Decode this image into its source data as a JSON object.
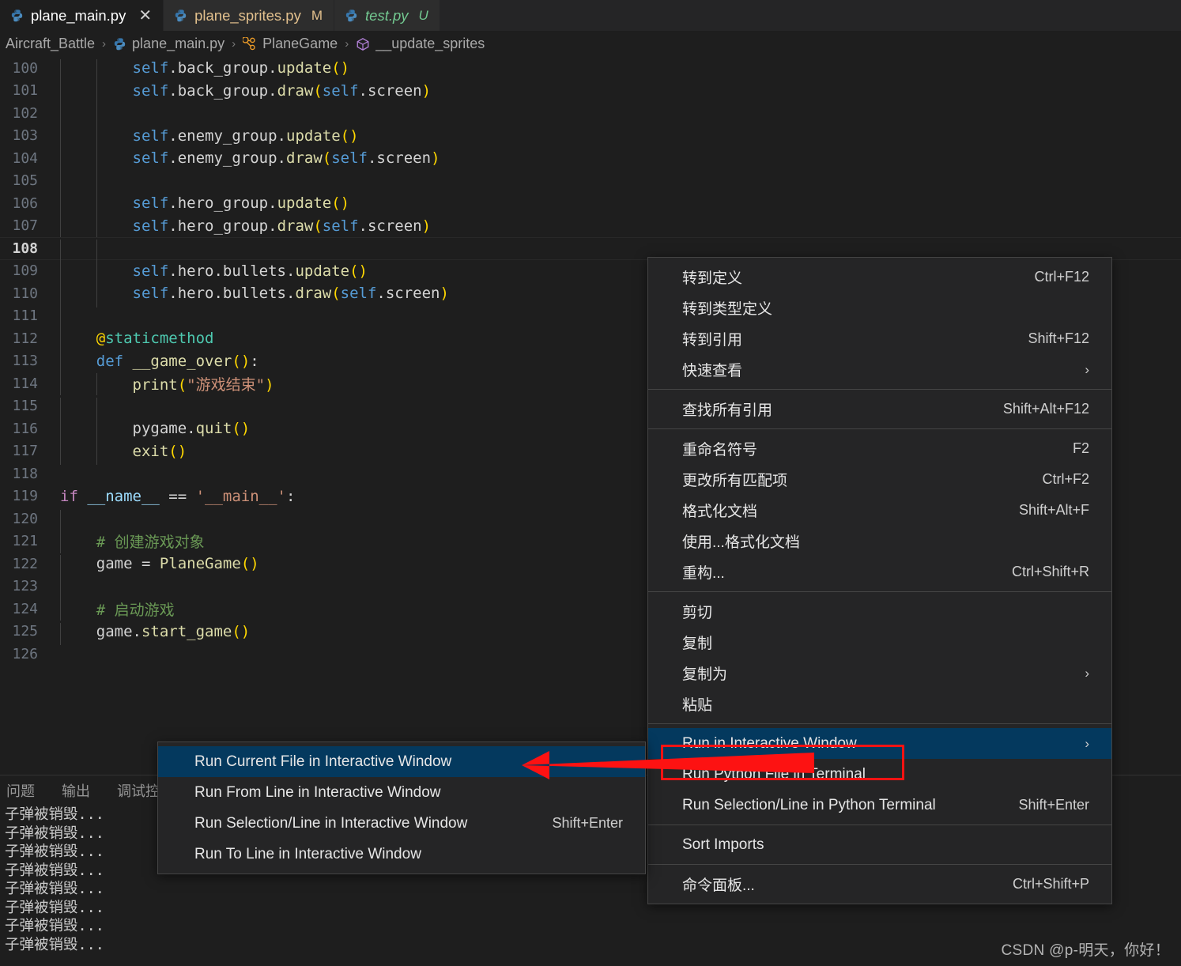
{
  "window": {
    "theme_bg": "#1e1e1e",
    "accent_highlight": "#04395e",
    "annotation_color": "#fd1212"
  },
  "tabs": [
    {
      "label": "plane_main.py",
      "badge": "",
      "close": "✕",
      "state": "active",
      "icon": "python-icon"
    },
    {
      "label": "plane_sprites.py",
      "badge": "M",
      "close": "",
      "state": "modified",
      "icon": "python-icon"
    },
    {
      "label": "test.py",
      "badge": "U",
      "close": "",
      "state": "untracked",
      "icon": "python-icon"
    }
  ],
  "breadcrumb": {
    "items": [
      {
        "label": "Aircraft_Battle",
        "icon": ""
      },
      {
        "label": "plane_main.py",
        "icon": "python-icon"
      },
      {
        "label": "PlaneGame",
        "icon": "class-icon"
      },
      {
        "label": "__update_sprites",
        "icon": "method-icon"
      }
    ],
    "separator": "›"
  },
  "editor": {
    "lines": [
      {
        "no": "100",
        "indent": 2,
        "current": false,
        "tokens": [
          {
            "t": "self",
            "c": "t-self"
          },
          {
            "t": ".back_group.",
            "c": "t-id"
          },
          {
            "t": "update",
            "c": "t-call"
          },
          {
            "t": "()",
            "c": "t-par"
          }
        ]
      },
      {
        "no": "101",
        "indent": 2,
        "current": false,
        "tokens": [
          {
            "t": "self",
            "c": "t-self"
          },
          {
            "t": ".back_group.",
            "c": "t-id"
          },
          {
            "t": "draw",
            "c": "t-call"
          },
          {
            "t": "(",
            "c": "t-par"
          },
          {
            "t": "self",
            "c": "t-self"
          },
          {
            "t": ".screen",
            "c": "t-id"
          },
          {
            "t": ")",
            "c": "t-par"
          }
        ]
      },
      {
        "no": "102",
        "indent": 2,
        "current": false,
        "tokens": []
      },
      {
        "no": "103",
        "indent": 2,
        "current": false,
        "tokens": [
          {
            "t": "self",
            "c": "t-self"
          },
          {
            "t": ".enemy_group.",
            "c": "t-id"
          },
          {
            "t": "update",
            "c": "t-call"
          },
          {
            "t": "()",
            "c": "t-par"
          }
        ]
      },
      {
        "no": "104",
        "indent": 2,
        "current": false,
        "tokens": [
          {
            "t": "self",
            "c": "t-self"
          },
          {
            "t": ".enemy_group.",
            "c": "t-id"
          },
          {
            "t": "draw",
            "c": "t-call"
          },
          {
            "t": "(",
            "c": "t-par"
          },
          {
            "t": "self",
            "c": "t-self"
          },
          {
            "t": ".screen",
            "c": "t-id"
          },
          {
            "t": ")",
            "c": "t-par"
          }
        ]
      },
      {
        "no": "105",
        "indent": 2,
        "current": false,
        "tokens": []
      },
      {
        "no": "106",
        "indent": 2,
        "current": false,
        "tokens": [
          {
            "t": "self",
            "c": "t-self"
          },
          {
            "t": ".hero_group.",
            "c": "t-id"
          },
          {
            "t": "update",
            "c": "t-call"
          },
          {
            "t": "()",
            "c": "t-par"
          }
        ]
      },
      {
        "no": "107",
        "indent": 2,
        "current": false,
        "tokens": [
          {
            "t": "self",
            "c": "t-self"
          },
          {
            "t": ".hero_group.",
            "c": "t-id"
          },
          {
            "t": "draw",
            "c": "t-call"
          },
          {
            "t": "(",
            "c": "t-par"
          },
          {
            "t": "self",
            "c": "t-self"
          },
          {
            "t": ".screen",
            "c": "t-id"
          },
          {
            "t": ")",
            "c": "t-par"
          }
        ]
      },
      {
        "no": "108",
        "indent": 2,
        "current": true,
        "tokens": []
      },
      {
        "no": "109",
        "indent": 2,
        "current": false,
        "tokens": [
          {
            "t": "self",
            "c": "t-self"
          },
          {
            "t": ".hero.bullets.",
            "c": "t-id"
          },
          {
            "t": "update",
            "c": "t-call"
          },
          {
            "t": "()",
            "c": "t-par"
          }
        ]
      },
      {
        "no": "110",
        "indent": 2,
        "current": false,
        "tokens": [
          {
            "t": "self",
            "c": "t-self"
          },
          {
            "t": ".hero.bullets.",
            "c": "t-id"
          },
          {
            "t": "draw",
            "c": "t-call"
          },
          {
            "t": "(",
            "c": "t-par"
          },
          {
            "t": "self",
            "c": "t-self"
          },
          {
            "t": ".screen",
            "c": "t-id"
          },
          {
            "t": ")",
            "c": "t-par"
          }
        ]
      },
      {
        "no": "111",
        "indent": 1,
        "current": false,
        "tokens": []
      },
      {
        "no": "112",
        "indent": 1,
        "current": false,
        "tokens": [
          {
            "t": "@",
            "c": "t-par"
          },
          {
            "t": "staticmethod",
            "c": "t-dec"
          }
        ]
      },
      {
        "no": "113",
        "indent": 1,
        "current": false,
        "tokens": [
          {
            "t": "def ",
            "c": "t-kw"
          },
          {
            "t": "__game_over",
            "c": "t-fn"
          },
          {
            "t": "()",
            "c": "t-par"
          },
          {
            "t": ":",
            "c": "t-id"
          }
        ]
      },
      {
        "no": "114",
        "indent": 2,
        "current": false,
        "tokens": [
          {
            "t": "print",
            "c": "t-call"
          },
          {
            "t": "(",
            "c": "t-par"
          },
          {
            "t": "\"游戏结束\"",
            "c": "t-str"
          },
          {
            "t": ")",
            "c": "t-par"
          }
        ]
      },
      {
        "no": "115",
        "indent": 2,
        "current": false,
        "tokens": []
      },
      {
        "no": "116",
        "indent": 2,
        "current": false,
        "tokens": [
          {
            "t": "pygame.",
            "c": "t-id"
          },
          {
            "t": "quit",
            "c": "t-call"
          },
          {
            "t": "()",
            "c": "t-par"
          }
        ]
      },
      {
        "no": "117",
        "indent": 2,
        "current": false,
        "tokens": [
          {
            "t": "exit",
            "c": "t-call"
          },
          {
            "t": "()",
            "c": "t-par"
          }
        ]
      },
      {
        "no": "118",
        "indent": 0,
        "current": false,
        "tokens": []
      },
      {
        "no": "119",
        "indent": 0,
        "current": false,
        "tokens": [
          {
            "t": "if ",
            "c": "t-kw2"
          },
          {
            "t": "__name__",
            "c": "t-var"
          },
          {
            "t": " == ",
            "c": "t-id"
          },
          {
            "t": "'__main__'",
            "c": "t-str"
          },
          {
            "t": ":",
            "c": "t-id"
          }
        ]
      },
      {
        "no": "120",
        "indent": 1,
        "current": false,
        "tokens": []
      },
      {
        "no": "121",
        "indent": 1,
        "current": false,
        "tokens": [
          {
            "t": "# 创建游戏对象",
            "c": "t-cmt"
          }
        ]
      },
      {
        "no": "122",
        "indent": 1,
        "current": false,
        "tokens": [
          {
            "t": "game = ",
            "c": "t-id"
          },
          {
            "t": "PlaneGame",
            "c": "t-call"
          },
          {
            "t": "()",
            "c": "t-par"
          }
        ]
      },
      {
        "no": "123",
        "indent": 1,
        "current": false,
        "tokens": []
      },
      {
        "no": "124",
        "indent": 1,
        "current": false,
        "tokens": [
          {
            "t": "# 启动游戏",
            "c": "t-cmt"
          }
        ]
      },
      {
        "no": "125",
        "indent": 1,
        "current": false,
        "tokens": [
          {
            "t": "game.",
            "c": "t-id"
          },
          {
            "t": "start_game",
            "c": "t-call"
          },
          {
            "t": "()",
            "c": "t-par"
          }
        ]
      },
      {
        "no": "126",
        "indent": 0,
        "current": false,
        "tokens": []
      }
    ]
  },
  "panel": {
    "tabs": [
      {
        "label": "问题"
      },
      {
        "label": "输出"
      },
      {
        "label": "调试控"
      }
    ],
    "output_lines": [
      "子弹被销毁...",
      "子弹被销毁...",
      "子弹被销毁...",
      "子弹被销毁...",
      "子弹被销毁...",
      "子弹被销毁...",
      "子弹被销毁...",
      "子弹被销毁..."
    ]
  },
  "context_menu": {
    "groups": [
      {
        "items": [
          {
            "label": "转到定义",
            "shortcut": "Ctrl+F12",
            "chevron": false,
            "highlight": false
          },
          {
            "label": "转到类型定义",
            "shortcut": "",
            "chevron": false,
            "highlight": false
          },
          {
            "label": "转到引用",
            "shortcut": "Shift+F12",
            "chevron": false,
            "highlight": false
          },
          {
            "label": "快速查看",
            "shortcut": "",
            "chevron": true,
            "highlight": false
          }
        ]
      },
      {
        "items": [
          {
            "label": "查找所有引用",
            "shortcut": "Shift+Alt+F12",
            "chevron": false,
            "highlight": false
          }
        ]
      },
      {
        "items": [
          {
            "label": "重命名符号",
            "shortcut": "F2",
            "chevron": false,
            "highlight": false
          },
          {
            "label": "更改所有匹配项",
            "shortcut": "Ctrl+F2",
            "chevron": false,
            "highlight": false
          },
          {
            "label": "格式化文档",
            "shortcut": "Shift+Alt+F",
            "chevron": false,
            "highlight": false
          },
          {
            "label": "使用...格式化文档",
            "shortcut": "",
            "chevron": false,
            "highlight": false
          },
          {
            "label": "重构...",
            "shortcut": "Ctrl+Shift+R",
            "chevron": false,
            "highlight": false
          }
        ]
      },
      {
        "items": [
          {
            "label": "剪切",
            "shortcut": "",
            "chevron": false,
            "highlight": false
          },
          {
            "label": "复制",
            "shortcut": "",
            "chevron": false,
            "highlight": false
          },
          {
            "label": "复制为",
            "shortcut": "",
            "chevron": true,
            "highlight": false
          },
          {
            "label": "粘贴",
            "shortcut": "",
            "chevron": false,
            "highlight": false
          }
        ]
      },
      {
        "items": [
          {
            "label": "Run in Interactive Window",
            "shortcut": "",
            "chevron": true,
            "highlight": true
          },
          {
            "label": "Run Python File in Terminal",
            "shortcut": "",
            "chevron": false,
            "highlight": false
          },
          {
            "label": "Run Selection/Line in Python Terminal",
            "shortcut": "Shift+Enter",
            "chevron": false,
            "highlight": false
          }
        ]
      },
      {
        "items": [
          {
            "label": "Sort Imports",
            "shortcut": "",
            "chevron": false,
            "highlight": false
          }
        ]
      },
      {
        "items": [
          {
            "label": "命令面板...",
            "shortcut": "Ctrl+Shift+P",
            "chevron": false,
            "highlight": false
          }
        ]
      }
    ]
  },
  "submenu": {
    "items": [
      {
        "label": "Run Current File in Interactive Window",
        "shortcut": "",
        "highlight": true
      },
      {
        "label": "Run From Line in Interactive Window",
        "shortcut": "",
        "highlight": false
      },
      {
        "label": "Run Selection/Line in Interactive Window",
        "shortcut": "Shift+Enter",
        "highlight": false
      },
      {
        "label": "Run To Line in Interactive Window",
        "shortcut": "",
        "highlight": false
      }
    ]
  },
  "watermark": {
    "text": "CSDN @p-明天，你好！"
  }
}
